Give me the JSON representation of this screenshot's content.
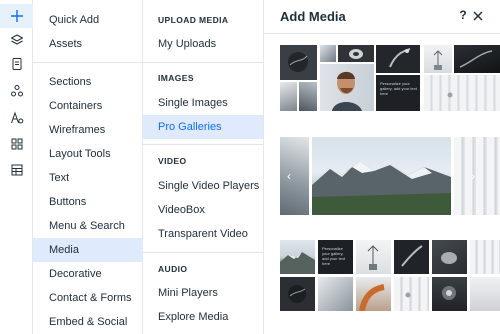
{
  "rail": {
    "items": [
      {
        "icon": "plus-icon",
        "active": true
      },
      {
        "icon": "layers-icon",
        "active": false
      },
      {
        "icon": "page-icon",
        "active": false
      },
      {
        "icon": "apps-icon",
        "active": false
      },
      {
        "icon": "text-style-icon",
        "active": false
      },
      {
        "icon": "grid-icon",
        "active": false
      },
      {
        "icon": "table-icon",
        "active": false
      }
    ]
  },
  "categories": {
    "top": [
      "Quick Add",
      "Assets"
    ],
    "items": [
      "Sections",
      "Containers",
      "Wireframes",
      "Layout Tools",
      "Text",
      "Buttons",
      "Menu & Search",
      "Media",
      "Decorative",
      "Contact & Forms",
      "Embed & Social"
    ],
    "active": "Media"
  },
  "submenu": {
    "groups": [
      {
        "heading": "UPLOAD MEDIA",
        "items": [
          "My Uploads"
        ]
      },
      {
        "heading": "IMAGES",
        "items": [
          "Single Images",
          "Pro Galleries"
        ]
      },
      {
        "heading": "VIDEO",
        "items": [
          "Single Video Players",
          "VideoBox",
          "Transparent Video"
        ]
      },
      {
        "heading": "AUDIO",
        "items": [
          "Mini Players",
          "Explore Media"
        ]
      }
    ],
    "active": "Pro Galleries"
  },
  "panel": {
    "title": "Add Media",
    "help": "?",
    "tile_text": "Personalize your gallery, add your text here",
    "slider_prev": "‹",
    "slider_next": "›"
  },
  "colors": {
    "accent": "#116dff",
    "active_bg": "#dfeafc",
    "rail_active_bg": "#e7f0ff",
    "divider": "#e3e7ec"
  }
}
